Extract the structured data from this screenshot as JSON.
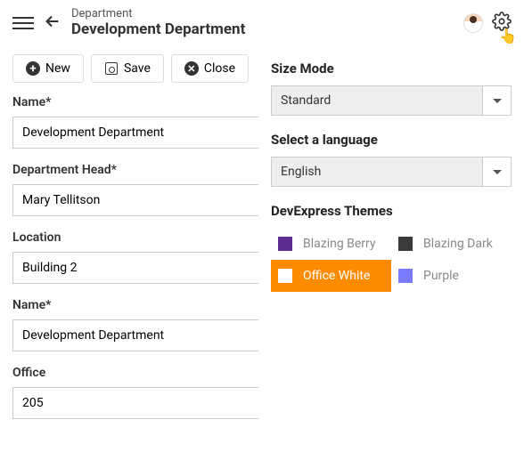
{
  "header": {
    "crumb": "Department",
    "title": "Development Department"
  },
  "toolbar": {
    "new": "New",
    "save": "Save",
    "close": "Close"
  },
  "fields": {
    "name": {
      "label": "Name*",
      "value": "Development Department"
    },
    "head": {
      "label": "Department Head*",
      "value": "Mary Tellitson"
    },
    "location": {
      "label": "Location",
      "value": "Building 2"
    },
    "name2": {
      "label": "Name*",
      "value": "Development Department"
    },
    "office": {
      "label": "Office",
      "value": "205"
    }
  },
  "panel": {
    "sizeModeTitle": "Size Mode",
    "sizeMode": "Standard",
    "langTitle": "Select a language",
    "language": "English",
    "themesTitle": "DevExpress Themes",
    "themes": {
      "blazingBerry": {
        "label": "Blazing Berry",
        "color": "#5c2d91"
      },
      "blazingDark": {
        "label": "Blazing Dark",
        "color": "#3a3a3a"
      },
      "officeWhite": {
        "label": "Office White",
        "color": "#ffffff"
      },
      "purple": {
        "label": "Purple",
        "color": "#7b7bff"
      }
    }
  }
}
